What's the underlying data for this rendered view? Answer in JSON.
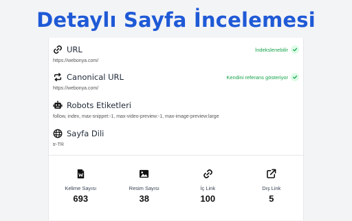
{
  "headline": "Detaylı Sayfa İncelemesi",
  "sections": [
    {
      "icon": "link-icon",
      "label": "URL",
      "value": "https://webonya.com/",
      "status": "İndekslenebilir",
      "status_color": "#16a34a"
    },
    {
      "icon": "repeat-icon",
      "label": "Canonical URL",
      "value": "https://webonya.com/",
      "status": "Kendini referans gösteriyor",
      "status_color": "#16a34a"
    },
    {
      "icon": "robot-icon",
      "label": "Robots Etiketleri",
      "value": "follow, index, max-snippet:-1, max-video-preview:-1, max-image-preview:large"
    },
    {
      "icon": "globe-icon",
      "label": "Sayfa Dili",
      "value": "tr-TR"
    }
  ],
  "stats": [
    {
      "icon": "word-file-icon",
      "label": "Kelime Sayısı",
      "value": "693"
    },
    {
      "icon": "image-icon",
      "label": "Resim Sayısı",
      "value": "38"
    },
    {
      "icon": "link-icon",
      "label": "İç Link",
      "value": "100"
    },
    {
      "icon": "external-link-icon",
      "label": "Dış Link",
      "value": "5"
    }
  ]
}
